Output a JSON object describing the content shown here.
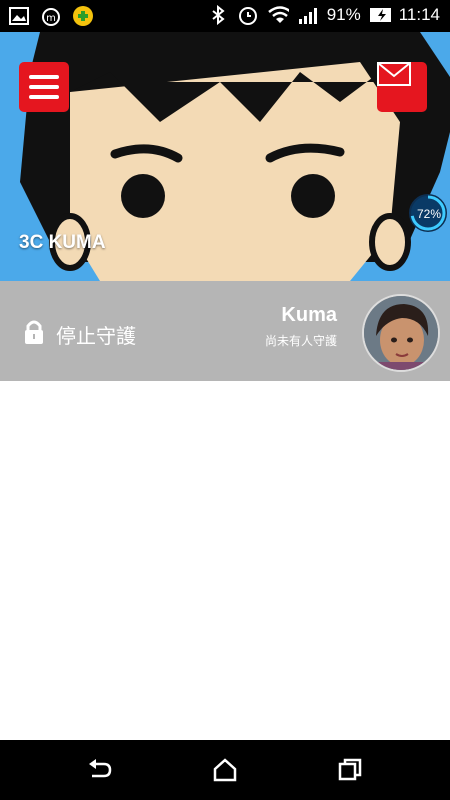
{
  "status_bar": {
    "battery_percent": "91%",
    "time": "11:14",
    "icons": [
      "image-icon",
      "alarm-app-icon",
      "game-app-icon",
      "bluetooth-icon",
      "alarm-clock-icon",
      "wifi-icon",
      "signal-icon",
      "battery-icon"
    ]
  },
  "header": {
    "title": "3C KUMA",
    "gauge_value": "72%",
    "gauge_fraction": 0.72,
    "menu_icon": "menu-icon",
    "mail_icon": "mail-icon",
    "accent_color": "#e5161f"
  },
  "watch": {
    "lock_icon": "lock-icon",
    "action_label": "停止守護",
    "user_name": "Kuma",
    "status_text": "尚未有人守護"
  },
  "nav_bar": {
    "icons": [
      "back-icon",
      "home-icon",
      "recent-apps-icon"
    ]
  }
}
